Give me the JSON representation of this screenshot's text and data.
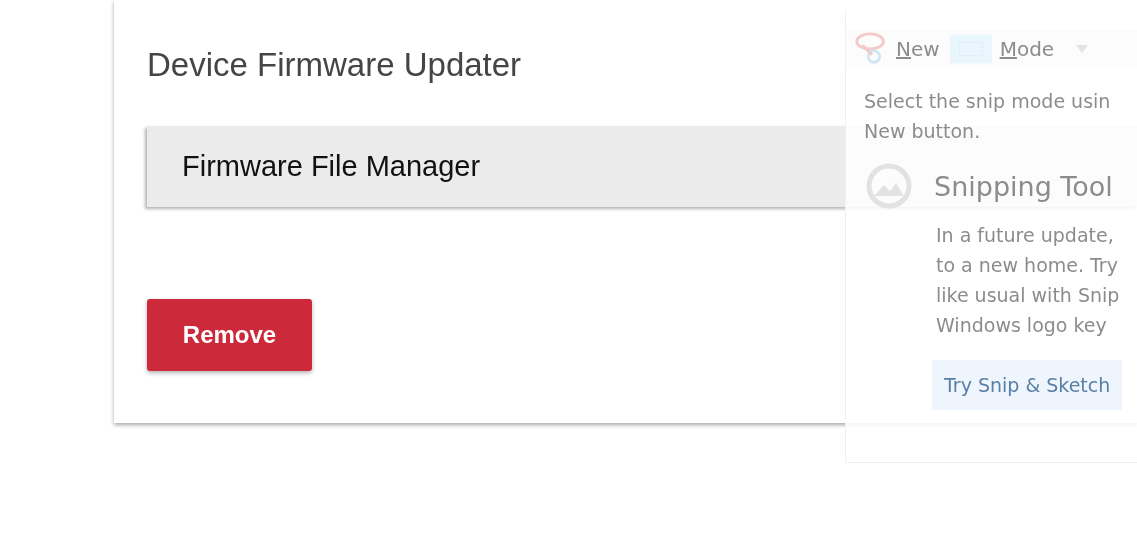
{
  "card": {
    "title": "Device Firmware Updater",
    "panel_title": "Firmware File Manager",
    "button": "Remove"
  },
  "overlay_window": {
    "toolbar": [
      {
        "label": "New",
        "kind": "new"
      },
      {
        "label": "Mode",
        "kind": "mode"
      }
    ],
    "hint": [
      "Select the snip mode usin",
      "New button."
    ],
    "notice": {
      "title": "Snipping Tool",
      "lines": [
        "In a future update,",
        "to a new home. Try",
        "like usual with Snip",
        "Windows logo key"
      ]
    },
    "button": "Try Snip & Sketch"
  }
}
